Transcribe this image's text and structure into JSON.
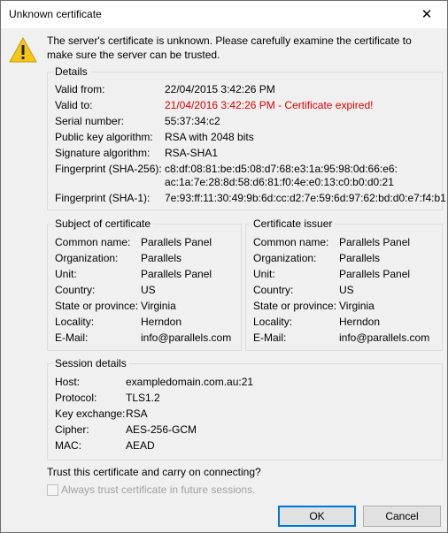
{
  "window": {
    "title": "Unknown certificate",
    "close_symbol": "✕"
  },
  "message": "The server's certificate is unknown. Please carefully examine the certificate to make sure the server can be trusted.",
  "details": {
    "legend": "Details",
    "valid_from_label": "Valid from:",
    "valid_from": "22/04/2015 3:42:26 PM",
    "valid_to_label": "Valid to:",
    "valid_to": "21/04/2016 3:42:26 PM - Certificate expired!",
    "serial_label": "Serial number:",
    "serial": "55:37:34:c2",
    "pubkey_label": "Public key algorithm:",
    "pubkey": "RSA with 2048 bits",
    "sigalg_label": "Signature algorithm:",
    "sigalg": "RSA-SHA1",
    "fp256_label": "Fingerprint (SHA-256):",
    "fp256_line1": "c8:df:08:81:be:d5:08:d7:68:e3:1a:95:98:0d:66:e6:",
    "fp256_line2": "ac:1a:7e:28:8d:58:d6:81:f0:4e:e0:13:c0:b0:d0:21",
    "fp1_label": "Fingerprint (SHA-1):",
    "fp1": "7e:93:ff:11:30:49:9b:6d:cc:d2:7e:59:6d:97:62:bd:d0:e7:f4:b1"
  },
  "subject": {
    "legend": "Subject of certificate",
    "labels": [
      "Common name:",
      "Organization:",
      "Unit:",
      "Country:",
      "State or province:",
      "Locality:",
      "E-Mail:"
    ],
    "values": [
      "Parallels Panel",
      "Parallels",
      "Parallels Panel",
      "US",
      "Virginia",
      "Herndon",
      "info@parallels.com"
    ]
  },
  "issuer": {
    "legend": "Certificate issuer",
    "labels": [
      "Common name:",
      "Organization:",
      "Unit:",
      "Country:",
      "State or province:",
      "Locality:",
      "E-Mail:"
    ],
    "values": [
      "Parallels Panel",
      "Parallels",
      "Parallels Panel",
      "US",
      "Virginia",
      "Herndon",
      "info@parallels.com"
    ]
  },
  "session": {
    "legend": "Session details",
    "labels": [
      "Host:",
      "Protocol:",
      "Key exchange:",
      "Cipher:",
      "MAC:"
    ],
    "values": [
      "exampledomain.com.au:21",
      "TLS1.2",
      "RSA",
      "AES-256-GCM",
      "AEAD"
    ]
  },
  "question": "Trust this certificate and carry on connecting?",
  "always_trust_label": "Always trust certificate in future sessions.",
  "buttons": {
    "ok": "OK",
    "cancel": "Cancel"
  },
  "colors": {
    "expired": "#e00000",
    "warning_fill": "#f5c518"
  }
}
